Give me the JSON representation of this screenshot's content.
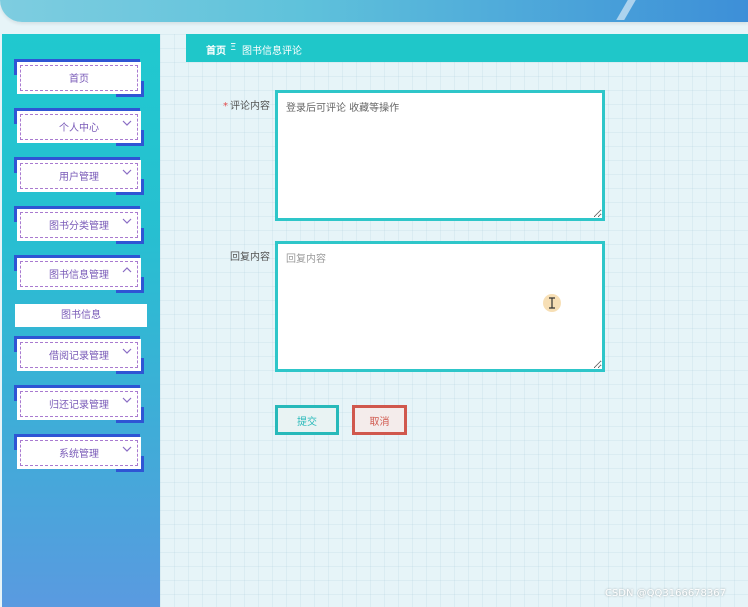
{
  "sidebar": {
    "items": [
      {
        "label": "首页",
        "has_chevron": false
      },
      {
        "label": "个人中心",
        "has_chevron": true,
        "chevron": "down"
      },
      {
        "label": "用户管理",
        "has_chevron": true,
        "chevron": "down"
      },
      {
        "label": "图书分类管理",
        "has_chevron": true,
        "chevron": "down"
      },
      {
        "label": "图书信息管理",
        "has_chevron": true,
        "chevron": "up"
      },
      {
        "label": "借阅记录管理",
        "has_chevron": true,
        "chevron": "down"
      },
      {
        "label": "归还记录管理",
        "has_chevron": true,
        "chevron": "down"
      },
      {
        "label": "系统管理",
        "has_chevron": true,
        "chevron": "down"
      }
    ],
    "sub_item": "图书信息"
  },
  "breadcrumb": {
    "home": "首页",
    "separator": "Ξ",
    "current": "图书信息评论"
  },
  "form": {
    "comment": {
      "required_mark": "*",
      "label": "评论内容",
      "value": "登录后可评论 收藏等操作",
      "placeholder": ""
    },
    "reply": {
      "label": "回复内容",
      "value": "",
      "placeholder": "回复内容"
    },
    "submit_label": "提交",
    "cancel_label": "取消"
  },
  "watermark": "CSDN @QQ3166678367",
  "colors": {
    "accent": "#1fc7c9",
    "menu_text": "#7a5bb8",
    "menu_corner": "#2f55d4",
    "cancel": "#d0584d"
  }
}
